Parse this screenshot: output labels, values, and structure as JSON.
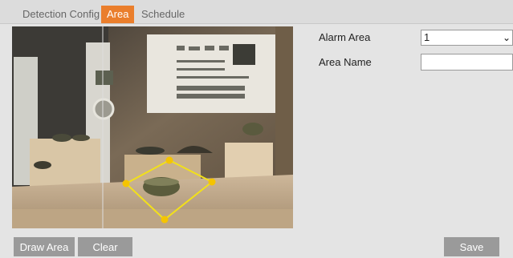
{
  "tabs": [
    {
      "label": "Detection Config",
      "active": false
    },
    {
      "label": "Area",
      "active": true
    },
    {
      "label": "Schedule",
      "active": false
    }
  ],
  "colors": {
    "accent": "#ea7e2c",
    "area_outline": "#f2e01a",
    "area_vertex": "#f5c400"
  },
  "video": {
    "icon": "camera-snapshot"
  },
  "form": {
    "alarm_area_label": "Alarm Area",
    "alarm_area_value": "1",
    "area_name_label": "Area Name",
    "area_name_value": ""
  },
  "buttons": {
    "draw_area": "Draw Area",
    "clear": "Clear",
    "save": "Save"
  }
}
